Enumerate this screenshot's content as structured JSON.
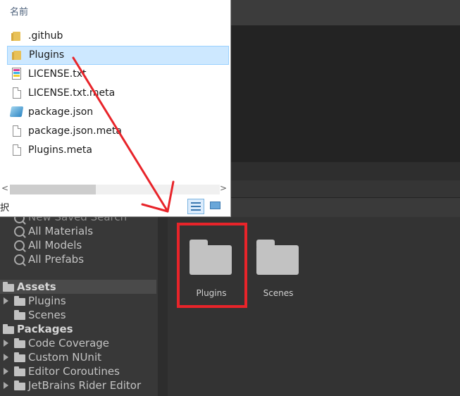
{
  "explorer": {
    "column_header": "名前",
    "items": [
      {
        "name": ".github",
        "icon": "folder-icon"
      },
      {
        "name": "Plugins",
        "icon": "folder-icon"
      },
      {
        "name": "LICENSE.txt",
        "icon": "text-file-icon"
      },
      {
        "name": "LICENSE.txt.meta",
        "icon": "file-icon"
      },
      {
        "name": "package.json",
        "icon": "json-file-icon"
      },
      {
        "name": "package.json.meta",
        "icon": "file-icon"
      },
      {
        "name": "Plugins.meta",
        "icon": "file-icon"
      }
    ],
    "selected_index": 1,
    "status_text": "択",
    "scroll_left": "<",
    "scroll_right": ">",
    "sort_caret": "^"
  },
  "sidebar": {
    "partial_item": "New Saved Search",
    "search_items": [
      "All Materials",
      "All Models",
      "All Prefabs"
    ],
    "assets": {
      "label": "Assets",
      "children": [
        "Plugins",
        "Scenes"
      ]
    },
    "packages": {
      "label": "Packages",
      "children": [
        "Code Coverage",
        "Custom NUnit",
        "Editor Coroutines",
        "JetBrains Rider Editor"
      ]
    }
  },
  "grid": {
    "items": [
      {
        "label": "Plugins",
        "icon": "folder-icon"
      },
      {
        "label": "Scenes",
        "icon": "folder-icon"
      }
    ]
  },
  "annotation": {
    "highlight_color": "#e8242a",
    "arrow_color": "#e8242a"
  }
}
